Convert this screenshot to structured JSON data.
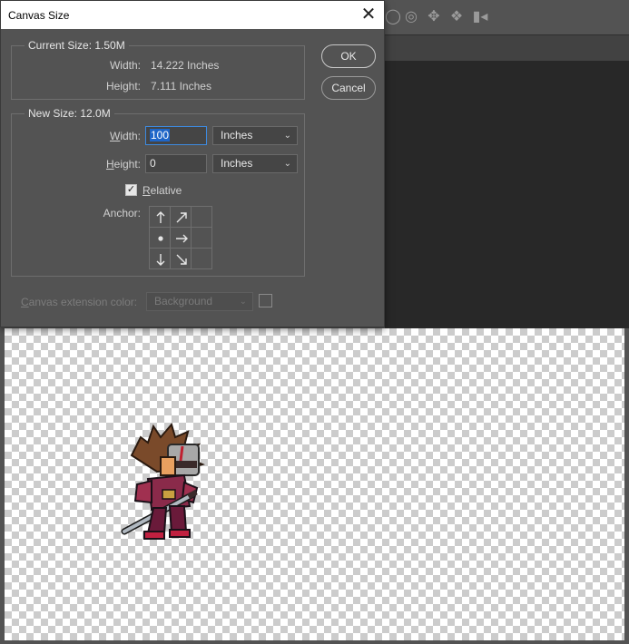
{
  "dialog": {
    "title": "Canvas Size",
    "current": {
      "legend": "Current Size: 1.50M",
      "width_label": "Width:",
      "width_value": "14.222 Inches",
      "height_label": "Height:",
      "height_value": "7.111 Inches"
    },
    "new": {
      "legend": "New Size: 12.0M",
      "width_label_pre": "",
      "width_label_u": "W",
      "width_label_post": "idth:",
      "width_value": "100",
      "width_unit": "Inches",
      "height_label_u": "H",
      "height_label_post": "eight:",
      "height_value": "0",
      "height_unit": "Inches",
      "relative_u": "R",
      "relative_post": "elative",
      "relative_checked": true,
      "anchor_label": "Anchor:"
    },
    "extension": {
      "label_u": "C",
      "label_post": "anvas extension color:",
      "value": "Background"
    },
    "buttons": {
      "ok": "OK",
      "cancel": "Cancel"
    }
  },
  "icons": [
    "close-icon",
    "chevron-down-icon",
    "check-icon",
    "arrow-up-icon",
    "arrow-up-right-icon",
    "arrow-right-icon",
    "arrow-down-icon",
    "arrow-down-right-icon",
    "anchor-dot-icon",
    "orbit-3d-icon",
    "pan-3d-icon",
    "slide-3d-icon",
    "scale-3d-icon",
    "camera-3d-icon"
  ]
}
